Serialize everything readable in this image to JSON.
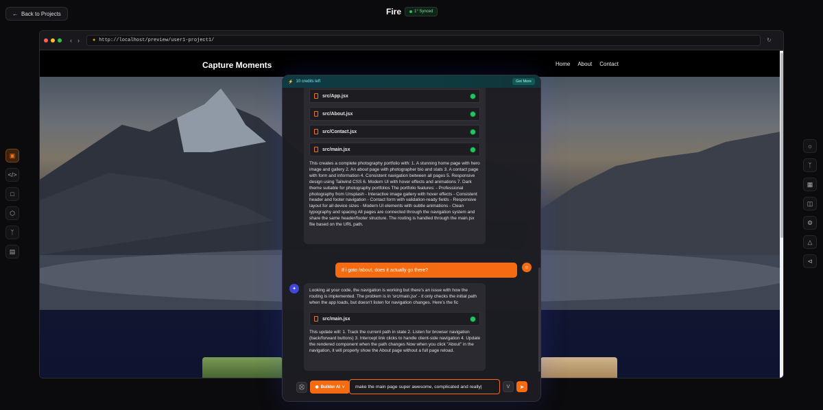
{
  "header": {
    "back_label": "Back to Projects",
    "project_title": "Fire",
    "sync_label": "1° Synced"
  },
  "browser": {
    "url": "http://localhost/preview/user1-project1/"
  },
  "site": {
    "brand": "Capture Moments",
    "nav": [
      "Home",
      "About",
      "Contact"
    ]
  },
  "chat": {
    "credits": "10 credits left",
    "get_more": "Get More",
    "files_top": [
      "src/App.jsx",
      "src/About.jsx",
      "src/Contact.jsx",
      "src/main.jsx"
    ],
    "summary": "This creates a complete photography portfolio with: 1. A stunning home page with hero image and gallery 2. An about page with photographer bio and stats 3. A contact page with form and information 4. Consistent navigation between all pages 5. Responsive design using Tailwind CSS 6. Modern UI with hover effects and animations 7. Dark theme suitable for photography portfolios The portfolio features: - Professional photography from Unsplash - Interactive image gallery with hover effects - Consistent header and footer navigation - Contact form with validation-ready fields - Responsive layout for all device sizes - Modern UI elements with subtle animations - Clean typography and spacing All pages are connected through the navigation system and share the same header/footer structure. The routing is handled through the main.jsx file based on the URL path.",
    "user_message": "If i goto /about, does it actually go there?",
    "ai_reply": "Looking at your code, the navigation is working but there's an issue with how the routing is implemented. The problem is in 'src/main.jsx' - it only checks the initial path when the app loads, but doesn't listen for navigation changes. Here's the fic",
    "reply_file": "src/main.jsx",
    "reply_followup": "This update will: 1. Track the current path in state 2. Listen for browser navigation (back/forward buttons) 3. Intercept link clicks to handle client-side navigation 4. Update the rendered component when the path changes Now when you click \"About\" in the navigation, it will properly show the About page without a full page reload.",
    "model_label": "Builder AI",
    "prompt_value": "make the main page super awesome, complicated and really",
    "v_label": "V"
  },
  "colors": {
    "accent": "#f56b12",
    "success": "#22c55e",
    "credits_text": "#7ee7f0"
  },
  "icons": {
    "left_sidebar": [
      "monitor-icon",
      "code-icon",
      "folder-icon",
      "cube-icon",
      "branch-icon",
      "book-icon"
    ],
    "right_sidebar": [
      "sun-icon",
      "branch-icon",
      "image-icon",
      "layout-icon",
      "gear-icon",
      "flask-icon",
      "share-icon"
    ]
  }
}
